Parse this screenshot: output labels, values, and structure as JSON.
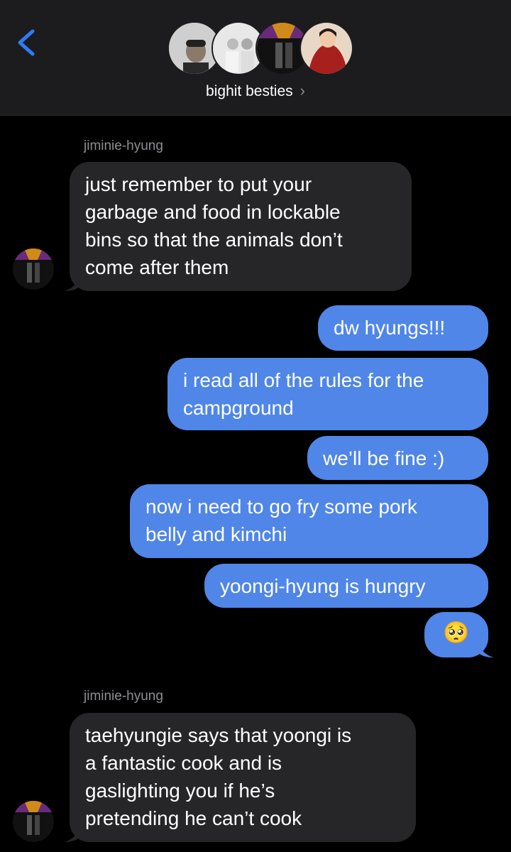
{
  "header": {
    "group_name": "bighit besties",
    "chevron": "›",
    "icons": [
      "chevron-left-icon",
      "chevron-right-icon"
    ],
    "accent": "#2f7bf5"
  },
  "colors": {
    "outgoing_bubble": "#4f86e8",
    "incoming_bubble": "#262628",
    "background": "#000000"
  },
  "messages": [
    {
      "type": "sender",
      "text": "jiminie-hyung"
    },
    {
      "type": "incoming",
      "text": "just remember to put your\ngarbage and food in lockable\nbins so that the animals don’t\ncome after them"
    },
    {
      "type": "outgoing",
      "text": "dw hyungs!!!"
    },
    {
      "type": "outgoing",
      "text": "i read all of the rules for the\ncampground"
    },
    {
      "type": "outgoing",
      "text": "we’ll be fine :)"
    },
    {
      "type": "outgoing",
      "text": "now i need to go fry some pork\nbelly and kimchi"
    },
    {
      "type": "outgoing",
      "text": "yoongi-hyung is hungry"
    },
    {
      "type": "outgoing",
      "text": "🥺"
    },
    {
      "type": "sender",
      "text": "jiminie-hyung"
    },
    {
      "type": "incoming",
      "text": "taehyungie says that yoongi is\na fantastic cook and is\ngaslighting you if he’s\npretending he can’t cook"
    }
  ]
}
